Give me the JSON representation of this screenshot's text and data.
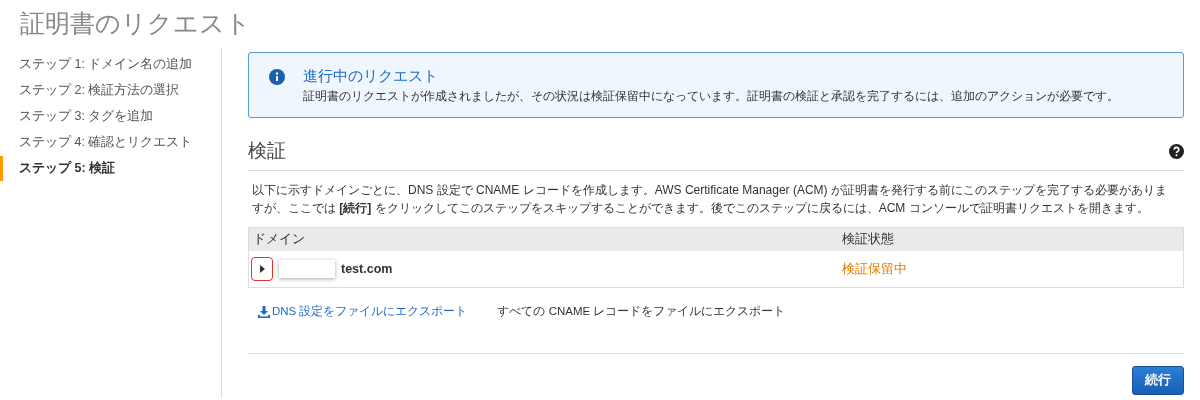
{
  "page_title": "証明書のリクエスト",
  "steps": [
    {
      "label": "ステップ 1: ドメイン名の追加",
      "selected": false
    },
    {
      "label": "ステップ 2: 検証方法の選択",
      "selected": false
    },
    {
      "label": "ステップ 3: タグを追加",
      "selected": false
    },
    {
      "label": "ステップ 4: 確認とリクエスト",
      "selected": false
    },
    {
      "label": "ステップ 5: 検証",
      "selected": true
    }
  ],
  "alert": {
    "title": "進行中のリクエスト",
    "message": "証明書のリクエストが作成されましたが、その状況は検証保留中になっています。証明書の検証と承認を完了するには、追加のアクションが必要です。"
  },
  "section": {
    "title": "検証",
    "description": "以下に示すドメインごとに、DNS 設定で CNAME レコードを作成します。AWS Certificate Manager (ACM) が証明書を発行する前にこのステップを完了する必要がありますが、ここでは **[続行]** をクリックしてこのステップをスキップすることができます。後でこのステップに戻るには、ACM コンソールで証明書リクエストを開きます。"
  },
  "table": {
    "columns": [
      "ドメイン",
      "検証状態"
    ],
    "rows": [
      {
        "domain": "test.com",
        "status": "検証保留中",
        "expanded": false
      }
    ]
  },
  "export_links": [
    "DNS 設定をファイルにエクスポート",
    "すべての CNAME レコードをファイルにエクスポート"
  ],
  "continue_button": "続行"
}
